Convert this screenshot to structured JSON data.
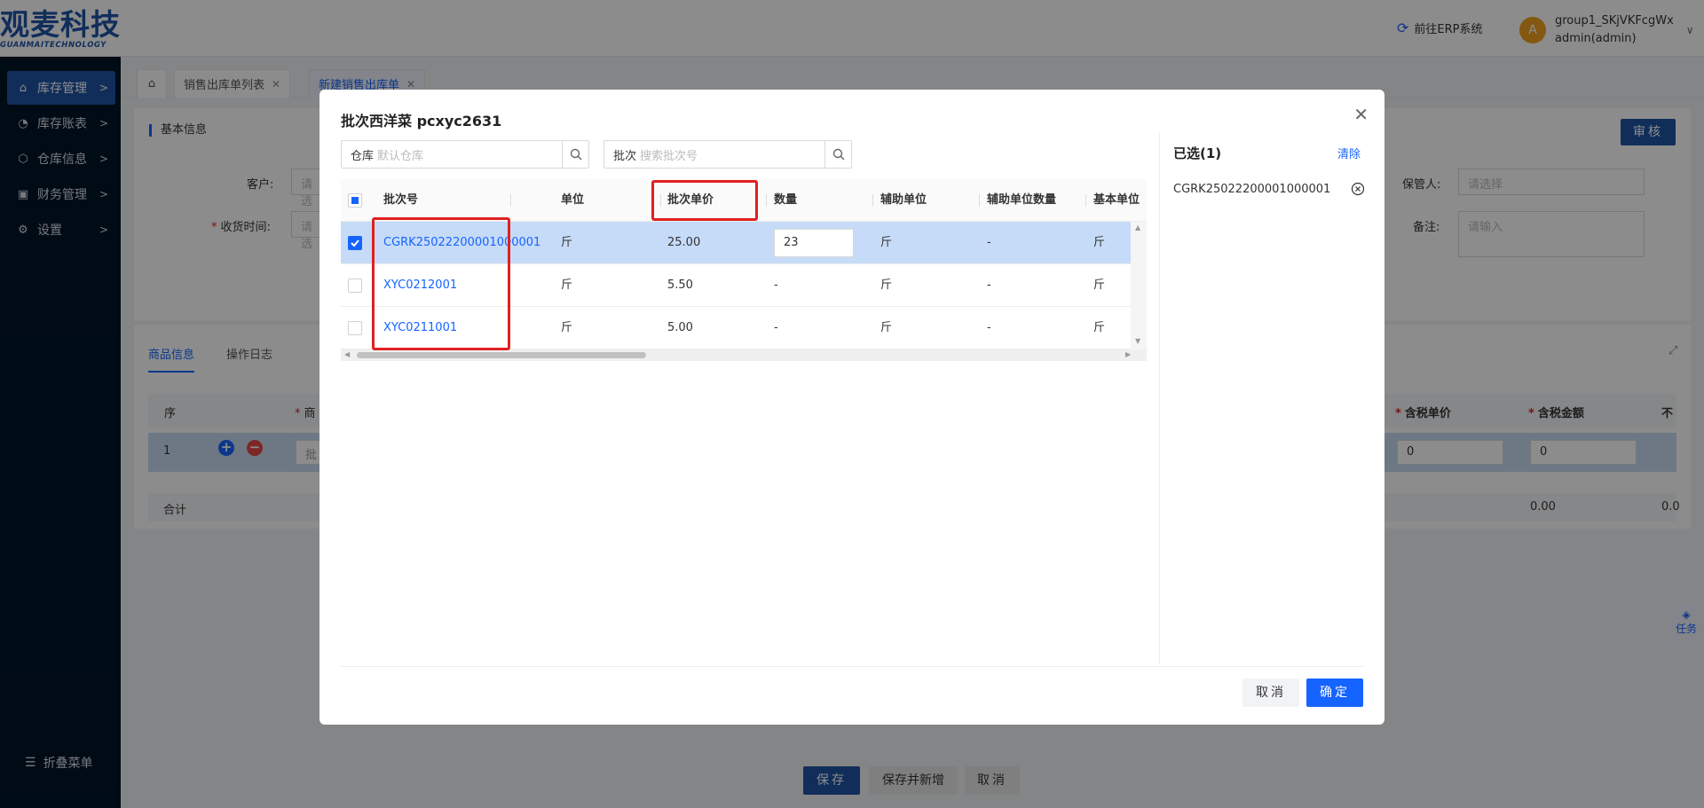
{
  "brand": {
    "logo_cn": "观麦科技",
    "logo_en": "GUANMAITECHNOLOGY",
    "color": "#1f55a6"
  },
  "header": {
    "erp_link": "前往ERP系统",
    "avatar_letter": "A",
    "user_group": "group1_SKjVKFcgWx",
    "user_name": "admin(admin)"
  },
  "sidebar": {
    "items": [
      {
        "label": "库存管理",
        "icon": "warehouse-icon",
        "active": true
      },
      {
        "label": "库存账表",
        "icon": "pie-chart-icon"
      },
      {
        "label": "仓库信息",
        "icon": "cube-icon"
      },
      {
        "label": "财务管理",
        "icon": "finance-icon"
      },
      {
        "label": "设置",
        "icon": "gear-icon"
      }
    ],
    "collapse_label": "折叠菜单"
  },
  "tabs": [
    {
      "label": "销售出库单列表"
    },
    {
      "label": "新建销售出库单",
      "active": true
    }
  ],
  "form": {
    "section_title": "基本信息",
    "audit_button": "审核",
    "customer_label": "客户:",
    "customer_placeholder": "请选",
    "receive_time_label": "收货时间:",
    "receive_time_placeholder": "请选",
    "keeper_label": "保管人:",
    "keeper_placeholder": "请选择",
    "remark_label": "备注:",
    "remark_placeholder": "请输入"
  },
  "goods": {
    "tabs": [
      "商品信息",
      "操作日志"
    ],
    "headers": {
      "index": "序",
      "product": "商",
      "tax_price": "含税单价",
      "tax_amount": "含税金额",
      "untaxed": "不"
    },
    "row": {
      "index": "1",
      "batch_prefix": "批",
      "tax_price": "0",
      "tax_amount": "0"
    },
    "sum": {
      "label": "合计",
      "amount": "0.00",
      "other": "0.0"
    }
  },
  "bottom": {
    "save": "保存",
    "save_new": "保存并新增",
    "cancel": "取消"
  },
  "task_float": "任务",
  "modal": {
    "title": "批次西洋菜 pcxyc2631",
    "warehouse_search": {
      "prefix": "仓库",
      "placeholder": "默认仓库"
    },
    "batch_search": {
      "prefix": "批次",
      "placeholder": "搜索批次号"
    },
    "columns": [
      "批次号",
      "单位",
      "批次单价",
      "数量",
      "辅助单位",
      "辅助单位数量",
      "基本单位"
    ],
    "rows": [
      {
        "batch": "CGRK25022200001000001",
        "unit": "斤",
        "price": "25.00",
        "qty": "23",
        "aux_unit": "斤",
        "aux_qty": "-",
        "base_unit": "斤",
        "checked": true
      },
      {
        "batch": "XYC0212001",
        "unit": "斤",
        "price": "5.50",
        "qty": "-",
        "aux_unit": "斤",
        "aux_qty": "-",
        "base_unit": "斤",
        "checked": false
      },
      {
        "batch": "XYC0211001",
        "unit": "斤",
        "price": "5.00",
        "qty": "-",
        "aux_unit": "斤",
        "aux_qty": "-",
        "base_unit": "斤",
        "checked": false
      }
    ],
    "selected_title": "已选(1)",
    "clear_label": "清除",
    "selected_items": [
      "CGRK25022200001000001"
    ],
    "cancel_label": "取消",
    "ok_label": "确定",
    "primary_color": "#1664ff",
    "highlight_color": "#e02020"
  }
}
